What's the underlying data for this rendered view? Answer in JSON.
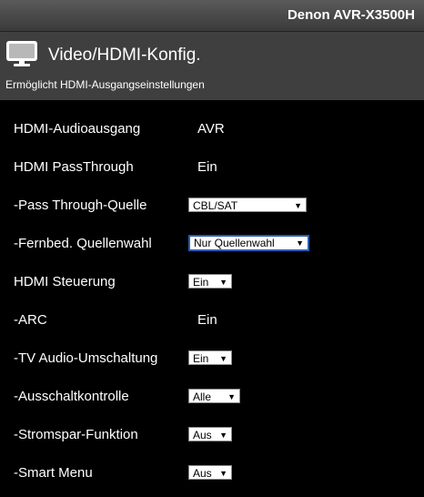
{
  "model": "Denon AVR-X3500H",
  "header": {
    "icon": "monitor-icon",
    "title": "Video/HDMI-Konfig.",
    "subtitle": "Ermöglicht HDMI-Ausgangseinstellungen"
  },
  "settings": [
    {
      "label": "HDMI-Audioausgang",
      "value": "AVR"
    },
    {
      "label": "HDMI PassThrough",
      "value": "Ein"
    },
    {
      "label": "-Pass Through-Quelle",
      "value": "CBL/SAT"
    },
    {
      "label": "-Fernbed. Quellenwahl",
      "value": "Nur Quellenwahl"
    },
    {
      "label": "HDMI Steuerung",
      "value": "Ein"
    },
    {
      "label": "-ARC",
      "value": "Ein"
    },
    {
      "label": "-TV Audio-Umschaltung",
      "value": "Ein"
    },
    {
      "label": "-Ausschaltkontrolle",
      "value": "Alle"
    },
    {
      "label": "-Stromspar-Funktion",
      "value": "Aus"
    },
    {
      "label": "-Smart Menu",
      "value": "Aus"
    }
  ],
  "dropdown_arrow": "▼"
}
